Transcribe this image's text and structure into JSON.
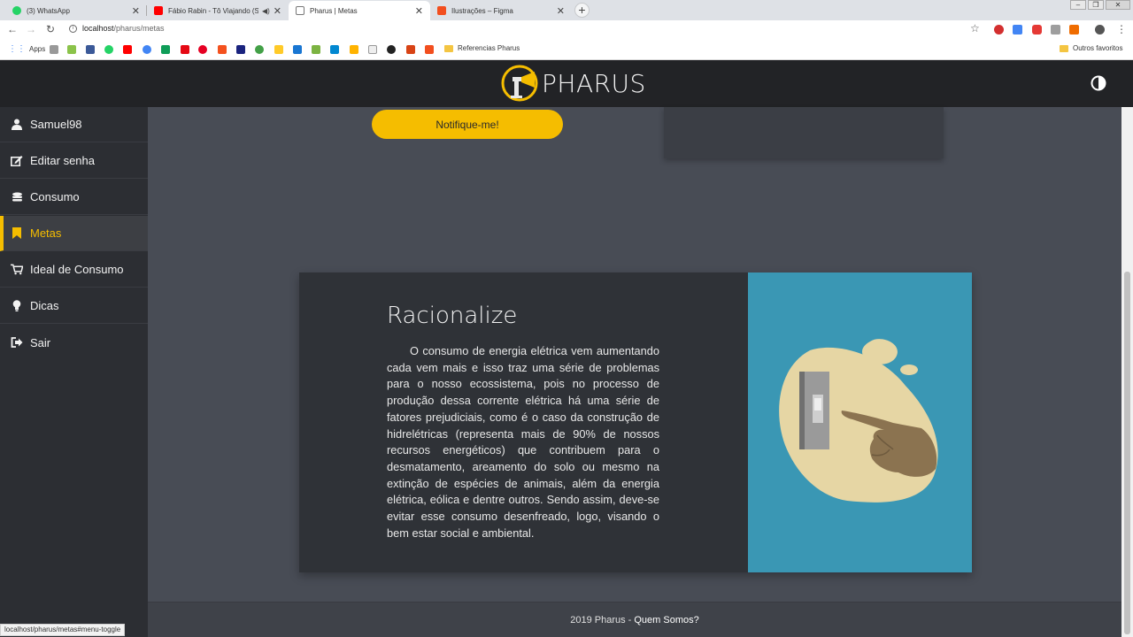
{
  "browser": {
    "tabs": [
      {
        "title": "(3) WhatsApp",
        "color": "#25d366"
      },
      {
        "title": "Fábio Rabin - Tô Viajando (S",
        "color": "#ff0000"
      },
      {
        "title": "Pharus | Metas",
        "color": "#555555"
      },
      {
        "title": "Ilustrações – Figma",
        "color": "#f24e1e"
      }
    ],
    "url_host": "localhost",
    "url_path": "/pharus/metas",
    "bookmarks_apps": "Apps",
    "bookmarks_folder": "Referencias Pharus",
    "bookmarks_other": "Outros favoritos",
    "status_url": "localhost/pharus/metas#menu-toggle"
  },
  "header": {
    "brand": "PHARUS",
    "accent": "#f5bd00"
  },
  "sidebar": {
    "items": [
      {
        "label": "Samuel98",
        "icon": "user-icon"
      },
      {
        "label": "Editar senha",
        "icon": "edit-icon"
      },
      {
        "label": "Consumo",
        "icon": "coins-icon"
      },
      {
        "label": "Metas",
        "icon": "bookmark-icon",
        "active": true
      },
      {
        "label": "Ideal de Consumo",
        "icon": "cart-icon"
      },
      {
        "label": "Dicas",
        "icon": "lightbulb-icon"
      },
      {
        "label": "Sair",
        "icon": "sign-out-icon"
      }
    ]
  },
  "main": {
    "notify_button": "Notifique-me!",
    "card": {
      "title": "Racionalize",
      "text": "O consumo de energia elétrica vem aumentando cada vem mais e isso traz uma série de problemas para o nosso ecossistema, pois no processo de produção dessa corrente elétrica há uma série de fatores prejudiciais, como é o caso da construção de hidrelétricas (representa mais de 90% de nossos recursos energéticos) que contribuem para o desmatamento, areamento do solo ou mesmo na extinção de espécies de animais, além da energia elétrica, eólica e dentre outros. Sendo assim, deve-se evitar esse consumo desenfreado, logo, visando o bem estar social e ambiental."
    }
  },
  "footer": {
    "copyright": "2019 Pharus -",
    "link": "Quem Somos?"
  }
}
